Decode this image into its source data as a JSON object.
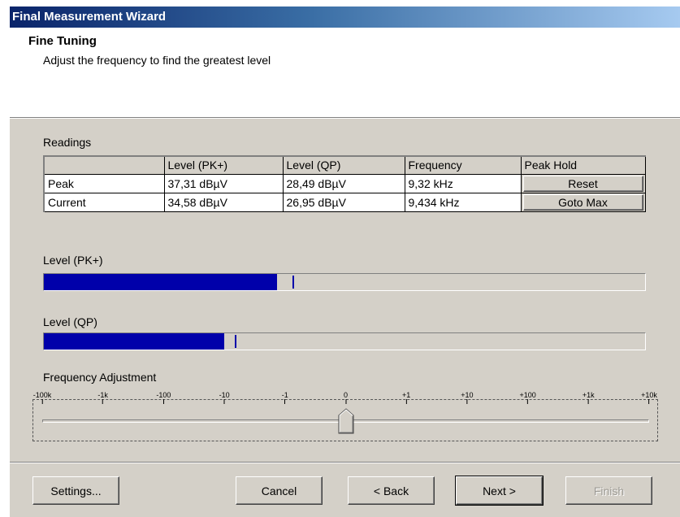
{
  "window": {
    "title": "Final Measurement Wizard"
  },
  "header": {
    "title": "Fine Tuning",
    "subtitle": "Adjust the frequency to find the greatest level"
  },
  "readings": {
    "group_label": "Readings",
    "columns": [
      "",
      "Level (PK+)",
      "Level (QP)",
      "Frequency",
      "Peak Hold"
    ],
    "rows": [
      {
        "label": "Peak",
        "pk": "37,31 dBµV",
        "qp": "28,49 dBµV",
        "freq": "9,32 kHz",
        "button": "Reset"
      },
      {
        "label": "Current",
        "pk": "34,58 dBµV",
        "qp": "26,95 dBµV",
        "freq": "9,434 kHz",
        "button": "Goto Max"
      }
    ]
  },
  "level_pk": {
    "label": "Level (PK+)",
    "fill": 0.388,
    "marker": 0.414
  },
  "level_qp": {
    "label": "Level (QP)",
    "fill": 0.3,
    "marker": 0.318
  },
  "freq_adjust": {
    "label": "Frequency Adjustment",
    "ticks": [
      "-100k",
      "-1k",
      "-100",
      "-10",
      "-1",
      "0",
      "+1",
      "+10",
      "+100",
      "+1k",
      "+10k"
    ],
    "value": "0",
    "fill_color": "#0000aa"
  },
  "buttons": {
    "settings": "Settings...",
    "cancel": "Cancel",
    "back": "< Back",
    "next": "Next >",
    "finish": "Finish"
  }
}
